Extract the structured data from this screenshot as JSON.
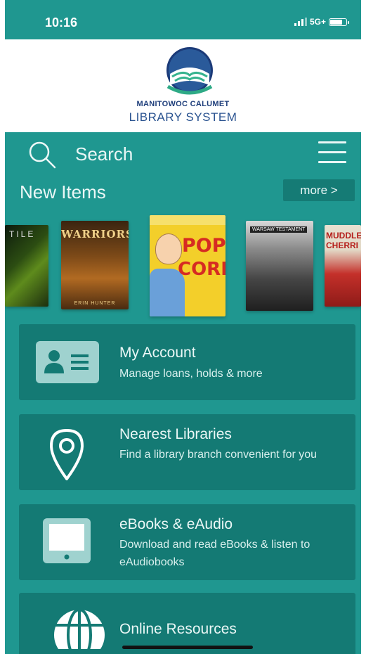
{
  "status_bar": {
    "time": "10:16",
    "network": "5G+"
  },
  "header": {
    "org_line1": "MANITOWOC CALUMET",
    "org_line2": "LIBRARY SYSTEM"
  },
  "search": {
    "label": "Search"
  },
  "new_items": {
    "title": "New Items",
    "more_label": "more >",
    "covers": [
      {
        "title": "TILE"
      },
      {
        "title": "WARRIORS",
        "author": "ERIN HUNTER"
      },
      {
        "title_line1": "POP",
        "title_line2": "CORN"
      },
      {
        "title": "WARSAW TESTAMENT"
      },
      {
        "title": "MUDDLE CHERRI"
      }
    ]
  },
  "cards": [
    {
      "title": "My Account",
      "subtitle": "Manage loans, holds & more"
    },
    {
      "title": "Nearest Libraries",
      "subtitle": "Find a library branch convenient for you"
    },
    {
      "title": "eBooks & eAudio",
      "subtitle": "Download and read eBooks & listen to eAudiobooks"
    },
    {
      "title": "Online Resources"
    }
  ],
  "colors": {
    "background": "#1f9790",
    "card": "#147a74",
    "brand_navy": "#1d3d7a"
  }
}
